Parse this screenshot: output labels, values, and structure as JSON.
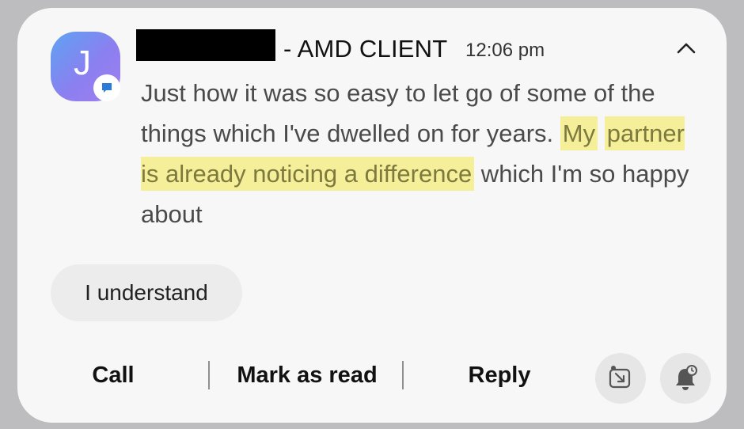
{
  "notification": {
    "avatar_letter": "J",
    "sender_suffix": "- AMD CLIENT",
    "time": "12:06 pm",
    "message_part1": "Just how it was so easy to let go of some of the things which I've dwelled on for years. ",
    "highlight_part1": "My",
    "highlight_part2": "partner is already noticing a difference",
    "message_part2": " which I'm so happy about",
    "highlight_color": "#f5ef9a",
    "avatar_gradient": [
      "#5ea3f2",
      "#a27fee"
    ]
  },
  "smart_reply": {
    "label": "I understand"
  },
  "actions": {
    "call": "Call",
    "mark_as_read": "Mark as read",
    "reply": "Reply"
  },
  "icons": {
    "collapse": "chevron-up-icon",
    "open_app": "open-external-icon",
    "snooze": "bell-snooze-icon",
    "message_badge": "chat-bubble-icon"
  }
}
